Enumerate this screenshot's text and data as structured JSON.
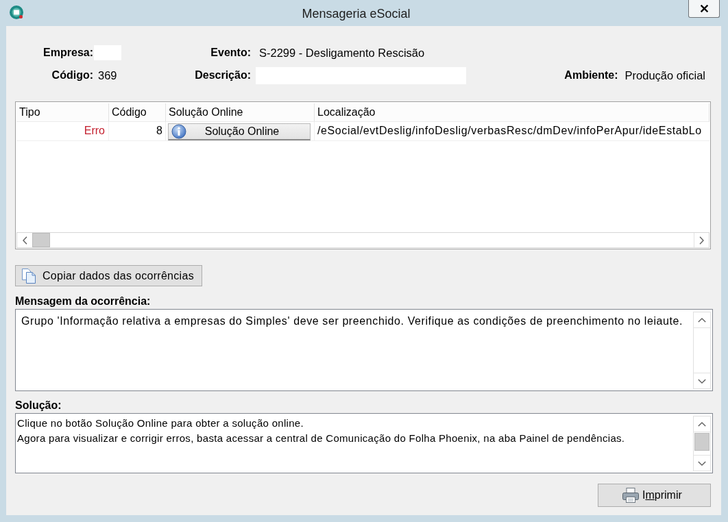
{
  "window": {
    "title": "Mensageria eSocial"
  },
  "header": {
    "fields": [
      {
        "label": "Empresa:",
        "redacted": true
      },
      {
        "label": "Evento:",
        "redacted": false,
        "value": "S-2299 - Desligamento Rescisão"
      },
      {
        "label": "Código:",
        "redacted": false,
        "value": "369"
      },
      {
        "label": "Descrição:",
        "redacted": true
      },
      {
        "label": "Ambiente:",
        "redacted": false,
        "value": "Produção oficial"
      }
    ]
  },
  "occurrences": {
    "columns": [
      "Tipo",
      "Código",
      "Solução Online",
      "Localização"
    ],
    "rows": [
      {
        "type": "Erro",
        "color": "#c4202f",
        "code": "8",
        "solution_button": "Solução Online",
        "location": "/eSocial/evtDeslig/infoDeslig/verbasResc/dmDev/infoPerApur/ideEstabLo"
      }
    ]
  },
  "copy_button": {
    "label": "Copiar dados das ocorrências"
  },
  "message": {
    "label": "Mensagem da ocorrência:",
    "text": "Grupo 'Informação relativa a empresas do Simples' deve ser preenchido. Verifique as condições de preenchimento no leiaute."
  },
  "solution": {
    "label": "Solução:",
    "lines": [
      "Clique no botão Solução Online para obter a solução online.",
      "Agora para visualizar e corrigir erros, basta acessar a central de Comunicação do Folha Phoenix, na aba Painel de pendências."
    ]
  },
  "print_button": {
    "label_parts": [
      {
        "text": "I",
        "underlined": false
      },
      {
        "text": "m",
        "underlined": true
      },
      {
        "text": "primir",
        "underlined": false
      }
    ]
  }
}
